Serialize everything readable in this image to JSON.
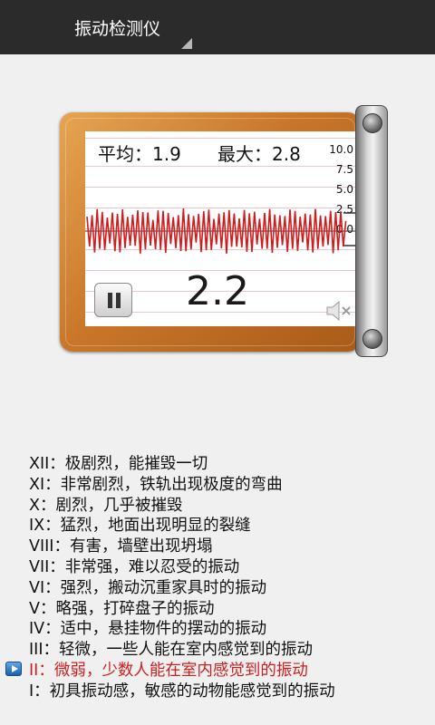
{
  "app": {
    "title": "振动检测仪"
  },
  "meter": {
    "avg_text": "平均：1.9",
    "max_text": "最大：2.8",
    "scale": [
      "10.0",
      "7.5",
      "5.0",
      "2.5",
      "0.0"
    ],
    "current_value": "2.2",
    "pause_icon": "pause-icon",
    "mute_icon": "speaker-muted-icon",
    "wave_color": "#d01c1c"
  },
  "legend": {
    "active_index": 10,
    "accent_color": "#cc1f1f",
    "items": [
      "XII：极剧烈，能摧毁一切",
      "XI：非常剧烈，铁轨出现极度的弯曲",
      "X：剧烈，几乎被摧毁",
      "IX：猛烈，地面出现明显的裂缝",
      "VIII：有害，墙壁出现坍塌",
      "VII：非常强，难以忍受的振动",
      "VI：强烈，搬动沉重家具时的振动",
      "V：略强，打碎盘子的振动",
      "IV：适中，悬挂物件的摆动的振动",
      "III：轻微，一些人能在室内感觉到的振动",
      "II：微弱，少数人能在室内感觉到的振动",
      "I：初具振动感，敏感的动物能感觉到的振动"
    ]
  }
}
